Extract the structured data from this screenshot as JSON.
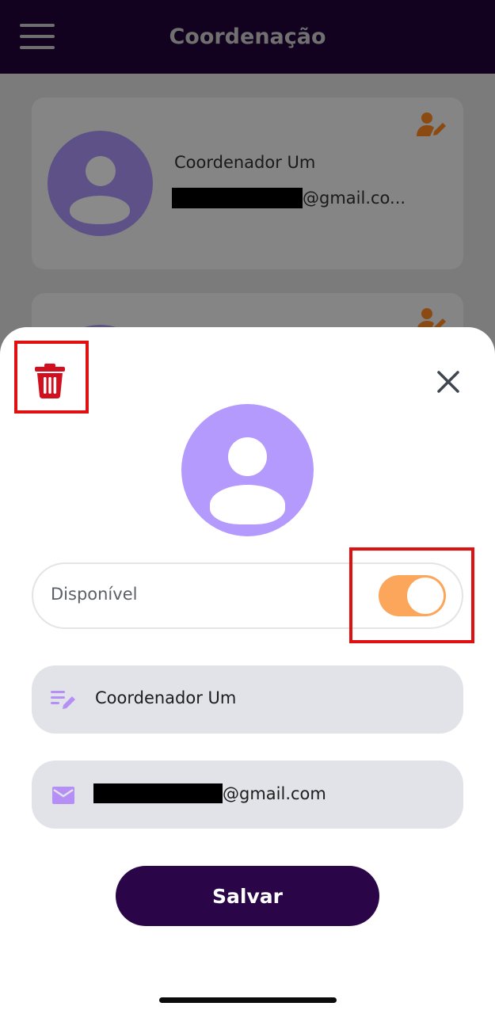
{
  "appbar": {
    "title": "Coordenação",
    "menu_icon": "hamburger-menu-icon"
  },
  "list": {
    "items": [
      {
        "name": "Coordenador Um",
        "email_suffix": "@gmail.co...",
        "edit_icon": "user-edit-icon",
        "avatar_icon": "person-avatar-icon"
      },
      {
        "name": "",
        "email_suffix": "",
        "edit_icon": "user-edit-icon",
        "avatar_icon": "person-avatar-icon"
      }
    ]
  },
  "sheet": {
    "delete_icon": "trash-icon",
    "close_icon": "close-icon",
    "avatar_icon": "person-avatar-icon",
    "availability": {
      "label": "Disponível",
      "enabled": true
    },
    "name_field": {
      "icon": "edit-note-icon",
      "value": "Coordenador Um"
    },
    "email_field": {
      "icon": "mail-icon",
      "value_suffix": "@gmail.com"
    },
    "save_label": "Salvar"
  },
  "colors": {
    "appbar": "#12021f",
    "accent_purple": "#b39afc",
    "toggle_on": "#fba65a",
    "delete_red": "#d0101e",
    "save_button": "#2a0648",
    "highlight": "#e01010"
  }
}
